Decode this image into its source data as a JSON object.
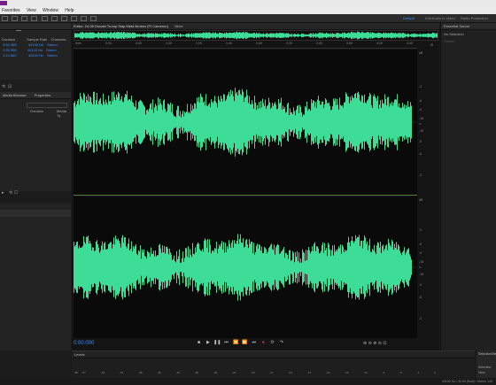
{
  "menu": {
    "items": [
      "Favorites",
      "View",
      "Window",
      "Help"
    ]
  },
  "toolbar": {
    "workspaces": [
      "Default",
      "Edit Audio to Video",
      "Radio Production"
    ],
    "active_workspace": "Default"
  },
  "files_panel": {
    "columns": [
      "Duration",
      "Sample Rate",
      "Channels"
    ],
    "rows": [
      {
        "duration": "3:54.368",
        "rate": "44100 Hz",
        "channels": "Stereo"
      },
      {
        "duration": "1:59.998",
        "rate": "44100 Hz",
        "channels": "Stereo"
      },
      {
        "duration": "1:13.560",
        "rate": "44100 Hz",
        "channels": "Stereo"
      }
    ]
  },
  "media_panel": {
    "tabs": [
      "Media Browser",
      "Properties"
    ],
    "columns": [
      "Duration",
      "Media Ty"
    ]
  },
  "editor": {
    "tabs": [
      "Editor: 24-05 Donald Trump Slap Meta Broken (Ft Cameron)",
      "Mixer"
    ],
    "time_ticks": [
      "hms",
      "0:20",
      "0:40",
      "1:00",
      "1:20",
      "1:40",
      "2:00",
      "2:20",
      "2:40",
      "3:00",
      "3:20",
      "3:40"
    ],
    "db_ticks": [
      "dB",
      "-3",
      "-6",
      "-9",
      "-15",
      "∞",
      "-15",
      "-9",
      "-6",
      "-3"
    ],
    "hud_value": "+0 dB",
    "timecode": "0:00.000"
  },
  "transport": {
    "buttons": [
      "stop",
      "play",
      "pause",
      "go-to-start",
      "rewind",
      "fast-forward",
      "go-to-end",
      "record",
      "loop",
      "skip"
    ]
  },
  "levels": {
    "title": "Levels",
    "scale": [
      "dB",
      "-57",
      "-54",
      "-51",
      "-48",
      "-45",
      "-42",
      "-39",
      "-36",
      "-33",
      "-30",
      "-27",
      "-24",
      "-21",
      "-18",
      "-15",
      "-12",
      "-9",
      "-6",
      "-3",
      "0"
    ]
  },
  "selection_view": {
    "title": "Selection/View",
    "label1": "Selection",
    "label2": "View"
  },
  "essential_sound": {
    "title": "Essential Sound",
    "subtitle": "No Selection",
    "preset_label": "Preset:"
  },
  "status": {
    "right": "44100 Hz • 32-bit (float) • Stereo     149"
  },
  "colors": {
    "waveform": "#3ddc97",
    "accent": "#3d8fff",
    "background": "#141414"
  }
}
